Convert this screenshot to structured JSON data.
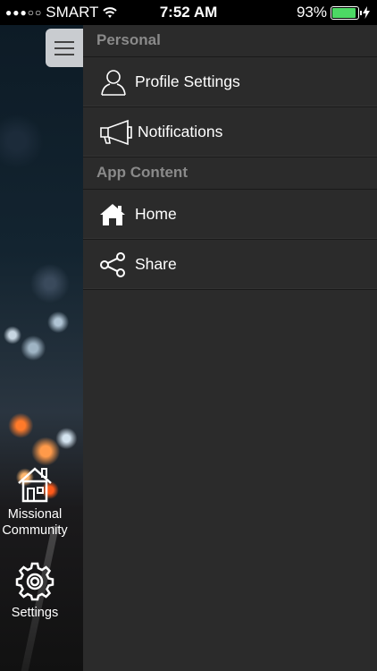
{
  "status_bar": {
    "signal_dots": "●●●○○",
    "carrier": "SMART",
    "time": "7:52 AM",
    "battery_percent": "93%",
    "battery_level": 0.93
  },
  "side_panel": {
    "items": [
      {
        "label": "Missional Community",
        "icon": "house-icon"
      },
      {
        "label": "Settings",
        "icon": "gear-icon"
      }
    ]
  },
  "menu": {
    "sections": [
      {
        "title": "Personal",
        "items": [
          {
            "label": "Profile Settings",
            "icon": "person-icon"
          },
          {
            "label": "Notifications",
            "icon": "megaphone-icon"
          }
        ]
      },
      {
        "title": "App Content",
        "items": [
          {
            "label": "Home",
            "icon": "home-icon"
          },
          {
            "label": "Share",
            "icon": "share-icon"
          }
        ]
      }
    ]
  },
  "colors": {
    "drawer_bg": "#2b2b2b",
    "section_header": "#8a8a8a",
    "battery_fill": "#4cd964"
  }
}
